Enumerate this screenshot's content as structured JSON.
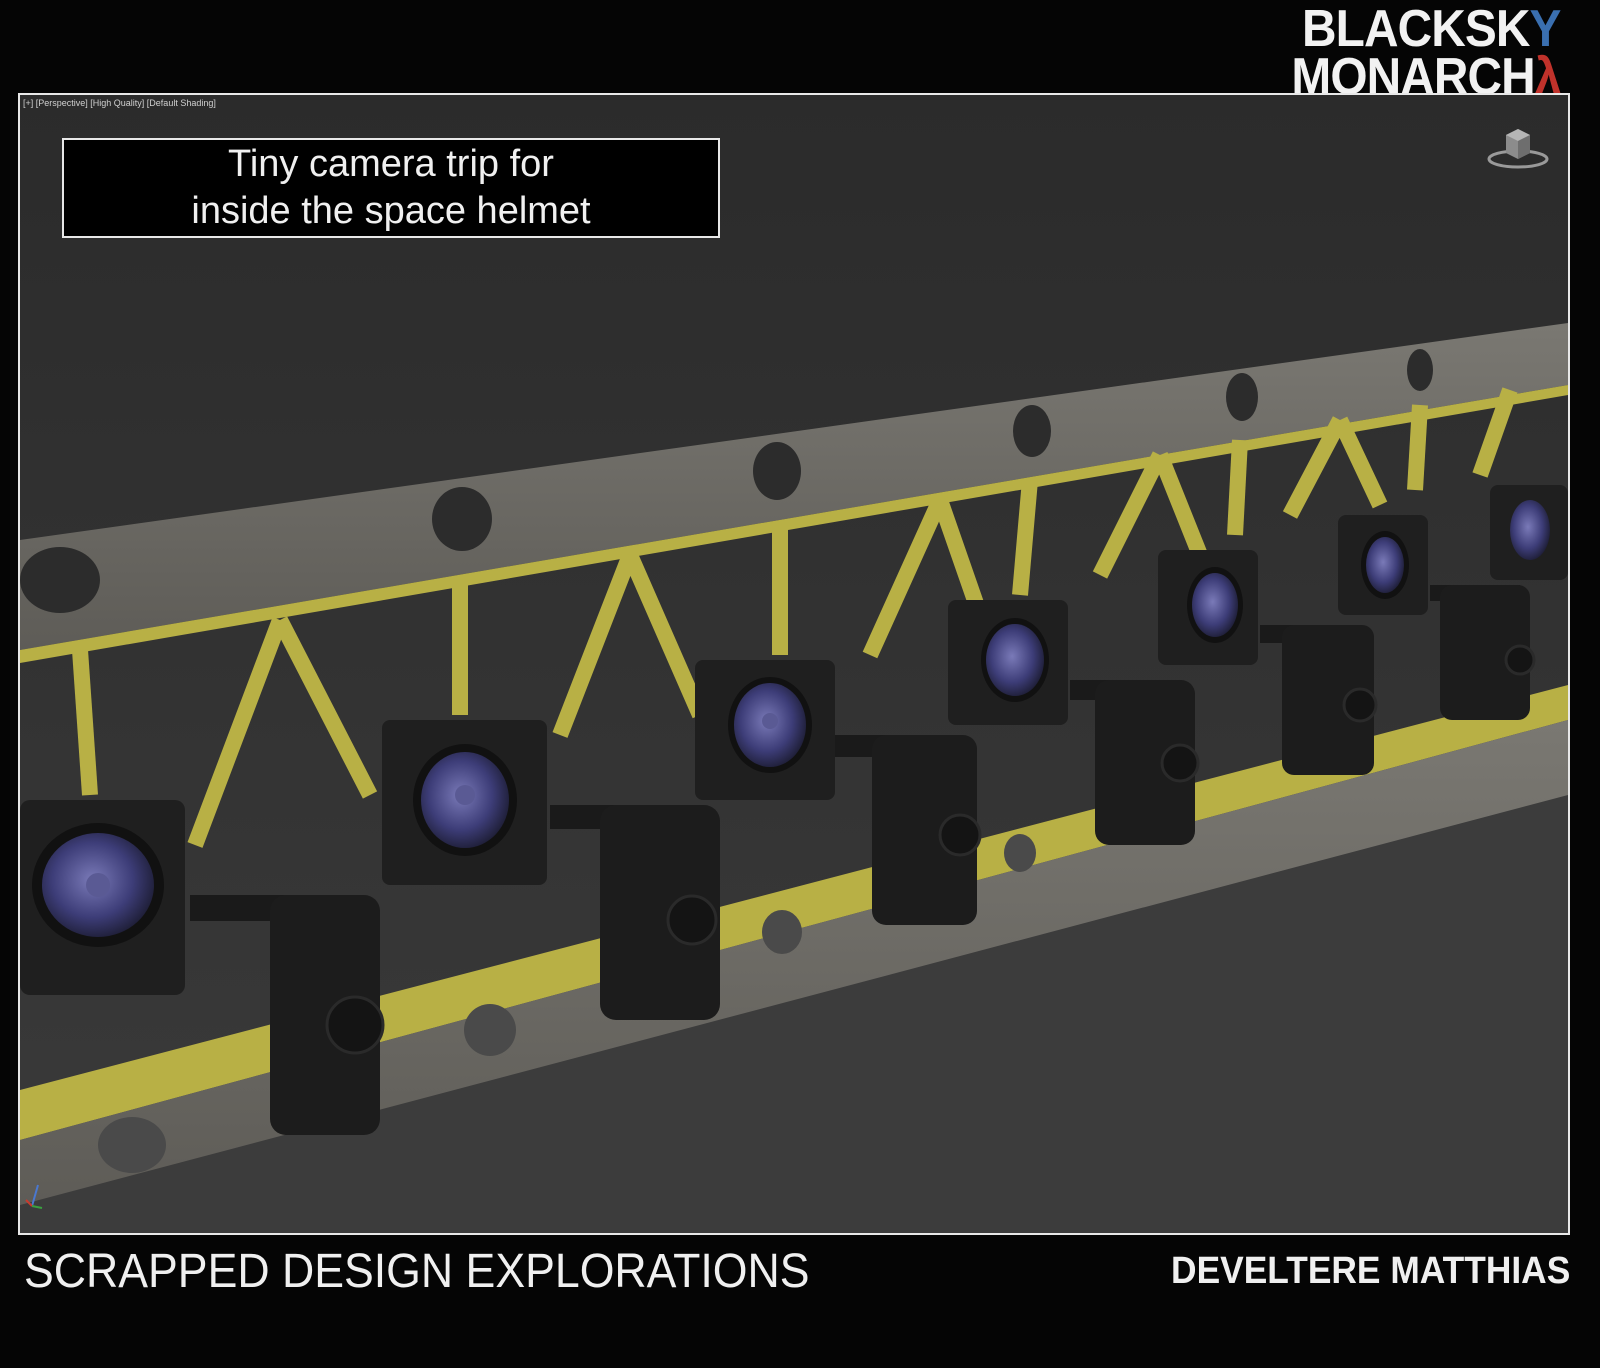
{
  "logo": {
    "line1_main": "BLACKSK",
    "line1_accent": "Y",
    "line2_main": "MONARCH",
    "line2_accent": "λ"
  },
  "viewport": {
    "label": "[+] [Perspective] [High Quality] [Default Shading]",
    "caption_line1": "Tiny camera trip for",
    "caption_line2": "inside the space helmet",
    "nav_cube_icon": "view-cube-icon",
    "axis_icon": "axis-gizmo-icon"
  },
  "footer": {
    "left_title": "SCRAPPED DESIGN EXPLORATIONS",
    "right_author": "DEVELTERE MATTHIAS"
  },
  "colors": {
    "background": "#050505",
    "viewport": "#2e2e2e",
    "rail": "#6e6c66",
    "bracket": "#b8b045",
    "lens": "#4a4a8a"
  }
}
